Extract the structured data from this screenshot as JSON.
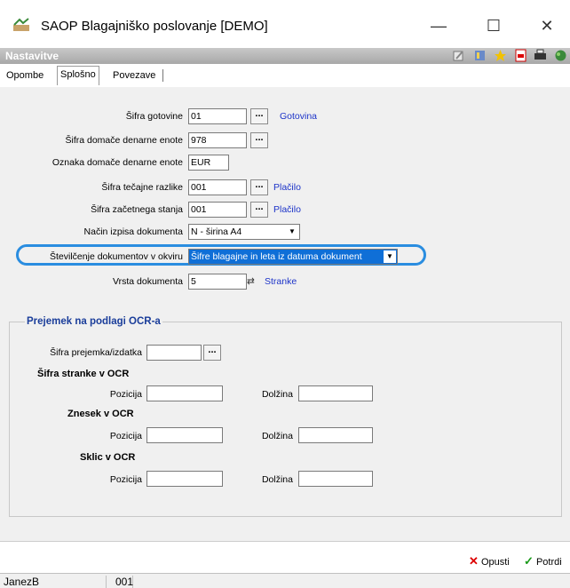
{
  "window": {
    "title": "SAOP Blagajniško poslovanje  [DEMO]",
    "minimize": "—",
    "maximize": "☐",
    "close": "✕"
  },
  "subbar": {
    "title": "Nastavitve"
  },
  "tabs": [
    "Opombe",
    "Splošno",
    "Povezave"
  ],
  "form": {
    "sifra_gotovine": {
      "label": "Šifra gotovine",
      "value": "01",
      "link": "Gotovina"
    },
    "sifra_domace": {
      "label": "Šifra domače denarne enote",
      "value": "978"
    },
    "oznaka_domace": {
      "label": "Oznaka domače denarne enote",
      "value": "EUR"
    },
    "sifra_tecajne": {
      "label": "Šifra tečajne razlike",
      "value": "001",
      "link": "Plačilo"
    },
    "sifra_zacetnega": {
      "label": "Šifra začetnega stanja",
      "value": "001",
      "link": "Plačilo"
    },
    "nacin_izpisa": {
      "label": "Način izpisa dokumenta",
      "value": "N - širina A4"
    },
    "stevilcenje": {
      "label": "Številčenje dokumentov v okviru",
      "value": "Šifre blagajne in leta iz datuma dokument"
    },
    "vrsta": {
      "label": "Vrsta dokumenta",
      "value": "5",
      "link": "Stranke"
    }
  },
  "ocr": {
    "title": "Prejemek na podlagi OCR-a",
    "sifra_label": "Šifra prejemka/izdatka",
    "sifra_value": "",
    "stranka_title": "Šifra stranke v OCR",
    "znesek_title": "Znesek v OCR",
    "sklic_title": "Sklic v OCR",
    "pozicija": "Pozicija",
    "dolzina": "Dolžina"
  },
  "buttons": {
    "opusti": "Opusti",
    "potrdi": "Potrdi",
    "dots": "...",
    "swap": "⇄"
  },
  "status": {
    "user": "JanezB",
    "code": "001"
  }
}
